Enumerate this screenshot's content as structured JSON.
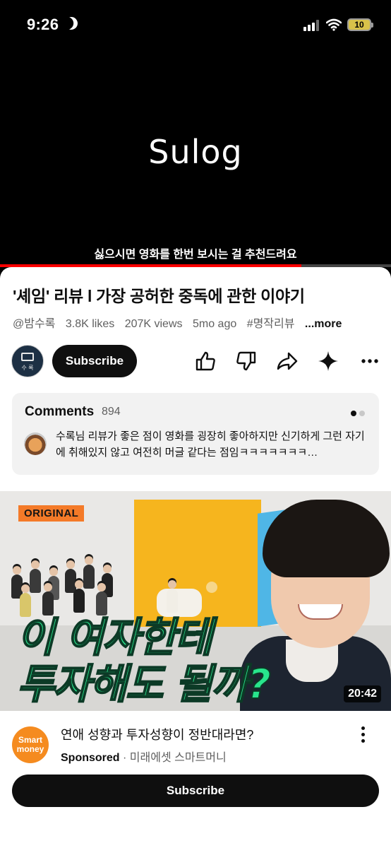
{
  "status_bar": {
    "time": "9:26",
    "battery": "10",
    "icons": [
      "moon-icon",
      "signal-icon",
      "wifi-icon",
      "battery-icon"
    ]
  },
  "video": {
    "title_text": "Sulog",
    "subtitle_text": "싫으시면 영화를 한번 보시는 걸 추천드려요",
    "progress": 0.77,
    "progress_color": "#ff0000"
  },
  "info": {
    "title": "'셰임' 리뷰 l 가장 공허한 중독에 관한 이야기",
    "channel_handle": "@밤수록",
    "likes": "3.8K likes",
    "views": "207K views",
    "age": "5mo ago",
    "hashtag": "#명작리뷰",
    "more_label": "...more"
  },
  "channel_row": {
    "subscribe_label": "Subscribe",
    "avatar_text": "수 록",
    "actions": [
      "like-icon",
      "dislike-icon",
      "share-icon",
      "sparkle-icon",
      "more-horizontal-icon"
    ]
  },
  "comments": {
    "label": "Comments",
    "count": "894",
    "top_comment": "수록님 리뷰가 좋은 점이 영화를 굉장히 좋아하지만 신기하게 그런 자기에 취해있지 않고 여전히 머글 같다는 점임ㅋㅋㅋㅋㅋㅋㅋ…"
  },
  "ad": {
    "badge": "ORIGINAL",
    "overlay_line1": "이 여자한테",
    "overlay_line2": "투자해도 될까?",
    "duration": "20:42",
    "logo_text": "Smart money",
    "title": "연애 성향과 투자성향이 정반대라면?",
    "sponsored": "Sponsored",
    "separator": "·",
    "advertiser": "미래에셋 스마트머니",
    "subscribe_label": "Subscribe"
  },
  "colors": {
    "accent_red": "#ff0000",
    "overlay_green": "#28e58c",
    "badge_orange": "#f47a28",
    "ad_logo_orange": "#f58b1f"
  }
}
